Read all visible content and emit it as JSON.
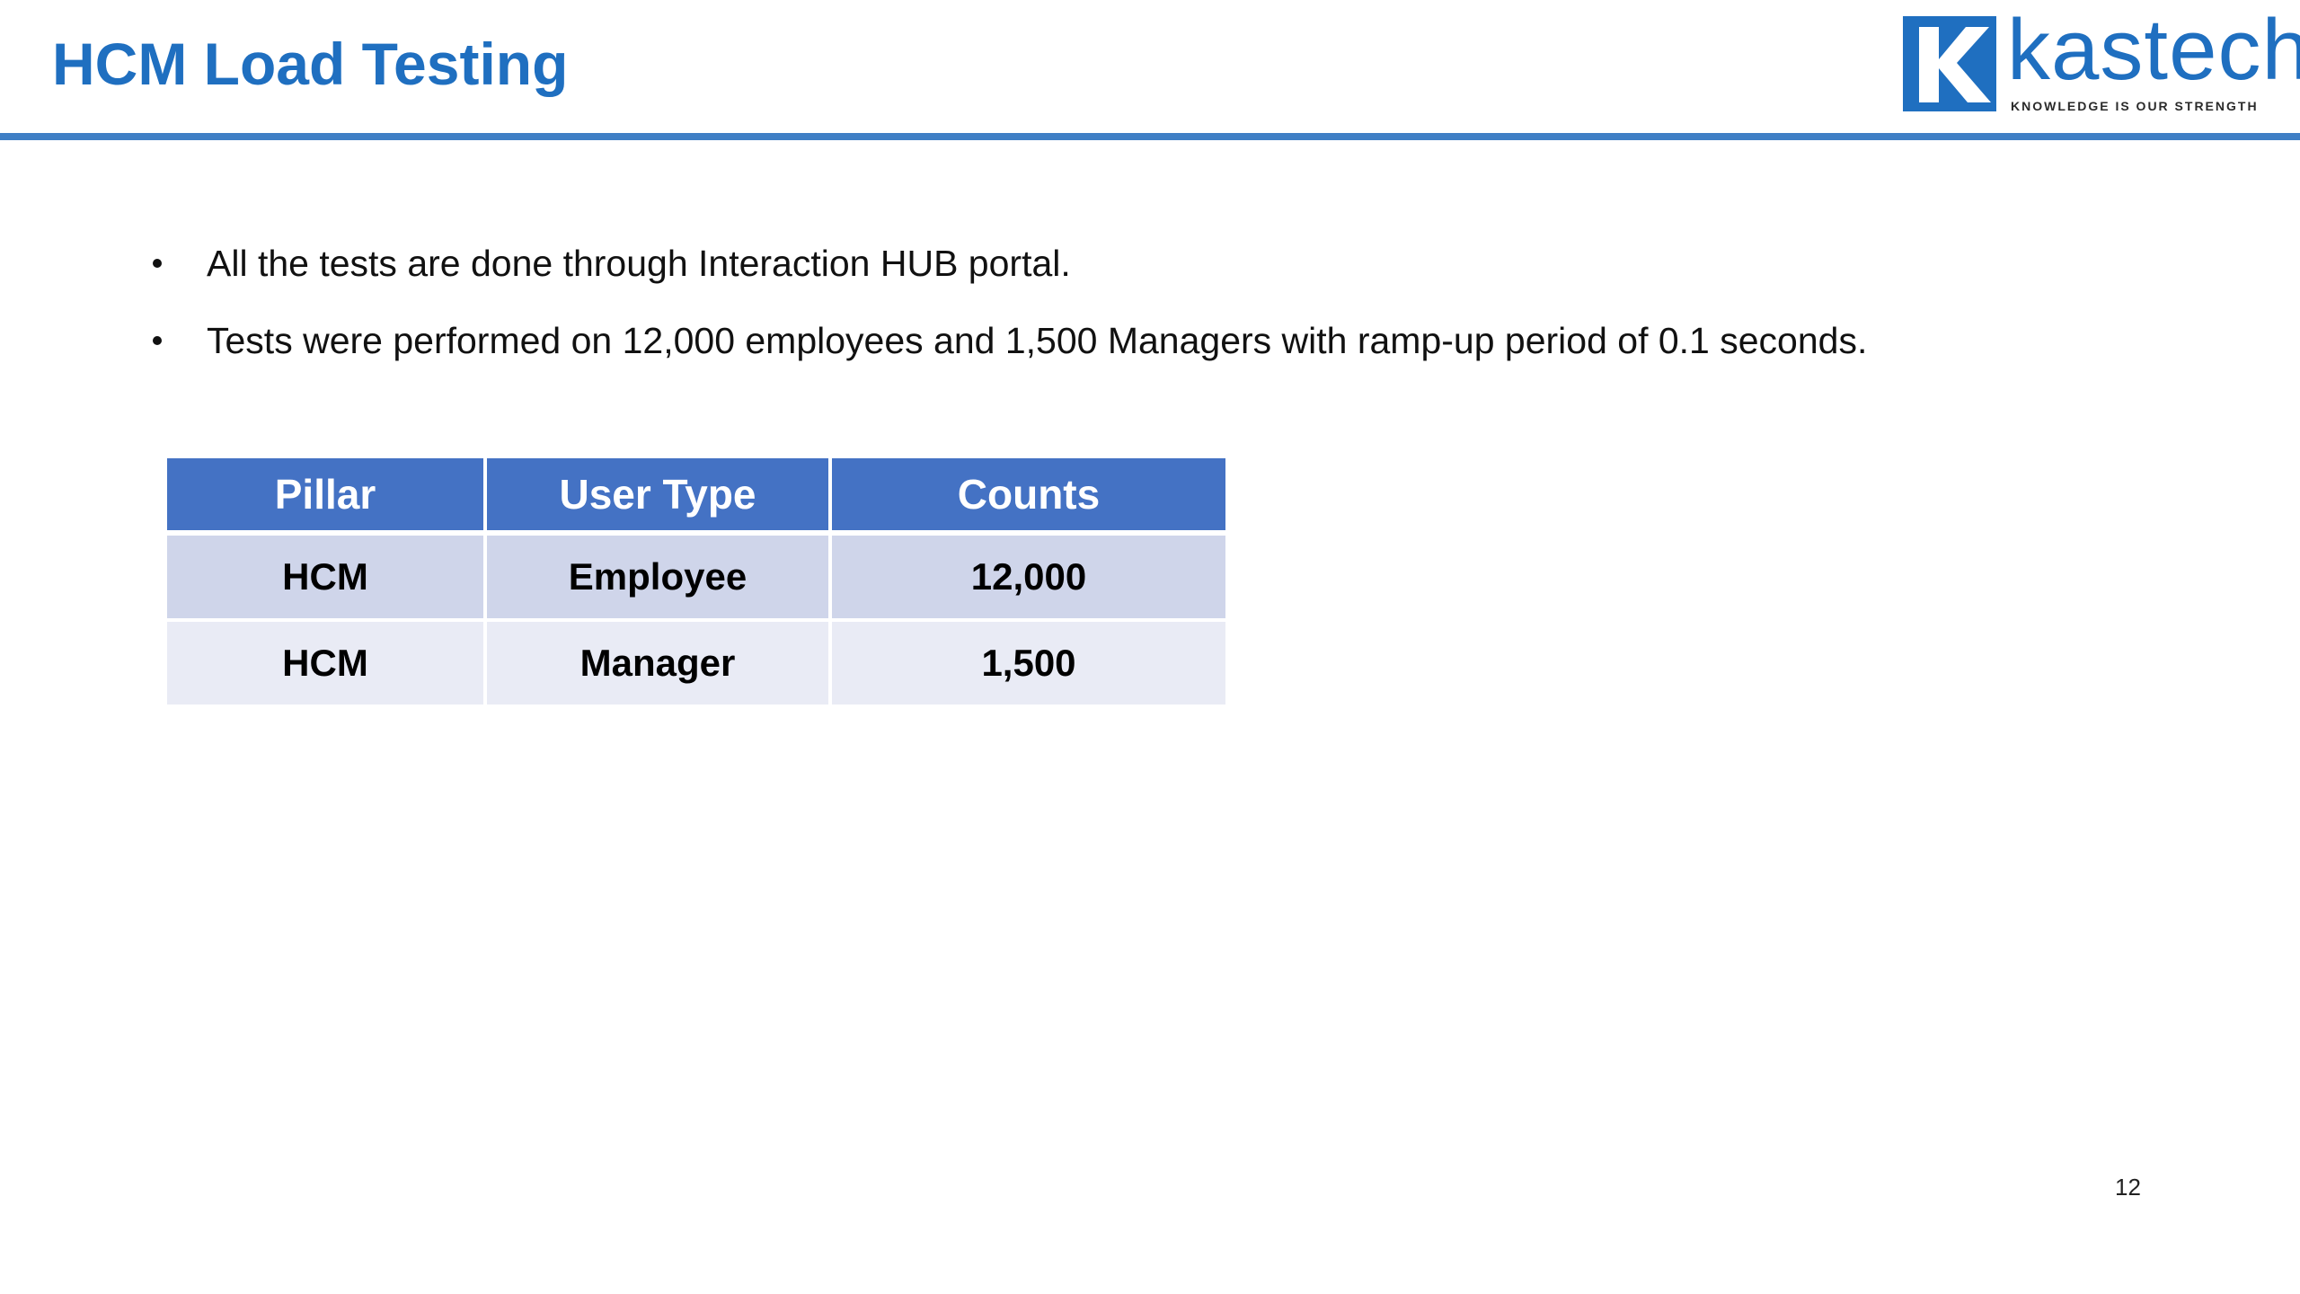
{
  "slide": {
    "title": "HCM Load Testing",
    "page_number": "12"
  },
  "logo": {
    "mark_letter": "K",
    "name": "kastech",
    "tagline": "KNOWLEDGE IS OUR STRENGTH"
  },
  "bullets": [
    "All the tests are done through Interaction HUB portal.",
    "Tests were performed on 12,000 employees and 1,500 Managers with ramp-up period of 0.1 seconds."
  ],
  "table": {
    "headers": [
      "Pillar",
      "User Type",
      "Counts"
    ],
    "rows": [
      [
        "HCM",
        "Employee",
        "12,000"
      ],
      [
        "HCM",
        "Manager",
        "1,500"
      ]
    ]
  },
  "colors": {
    "title": "#1f6fc0",
    "rule": "#3f7fc5",
    "table_header": "#4472c4",
    "row_odd": "#cfd5ea",
    "row_even": "#e9ebf5"
  }
}
